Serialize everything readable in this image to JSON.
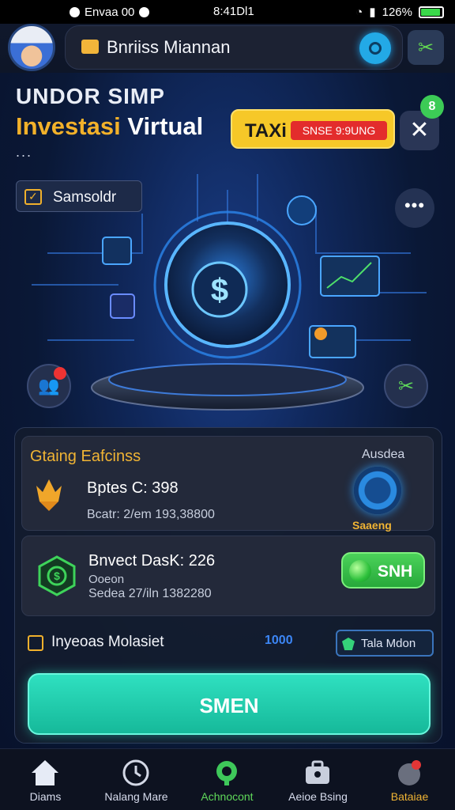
{
  "status_bar": {
    "left_text": "Envaa 00",
    "time": "8:41Dl1",
    "battery_text": "126%"
  },
  "header": {
    "title": "Bnriiss Miannan",
    "right_button_icon": "gear-icon",
    "far_right_icon": "tools-icon"
  },
  "hero": {
    "kicker": "UNDOR SIMP",
    "title_part1": "Investasi",
    "title_part2": "Virtual",
    "dots": "...",
    "promo_a": "TAXi",
    "promo_b": "SNSE 9:9UNG",
    "close_label": "✕",
    "close_badge": "8",
    "chip_label": "Samsoldr",
    "more_label": "•••"
  },
  "panel": {
    "card1": {
      "title": "Gtaing Eafcinss",
      "right_label": "Ausdea",
      "main": "Bptes C: 398",
      "sub": "Bcatr: 2/em 193,38800",
      "gear_label": "Saaeng"
    },
    "card2": {
      "main": "Bnvect DasK: 226",
      "sub1": "Ooeon",
      "sub2": "Sedea 27/iln 1382280",
      "button_label": "SNH"
    },
    "row3": {
      "label": "Inyeoas Molasiet",
      "mid": "1000",
      "button_label": "Tala Mdon"
    },
    "cta_label": "SMEN"
  },
  "bottom_nav": [
    {
      "label": "Diams",
      "icon": "home-icon"
    },
    {
      "label": "Nalang Mare",
      "icon": "clock-icon"
    },
    {
      "label": "Achnocont",
      "icon": "headset-icon"
    },
    {
      "label": "Aeioe Bsing",
      "icon": "briefcase-icon"
    },
    {
      "label": "Bataiae",
      "icon": "profile-icon"
    }
  ],
  "colors": {
    "accent_orange": "#f0b434",
    "accent_green": "#4bd35a",
    "accent_teal": "#2fe0c0",
    "accent_blue": "#23a9e6",
    "background": "#0b1530"
  }
}
